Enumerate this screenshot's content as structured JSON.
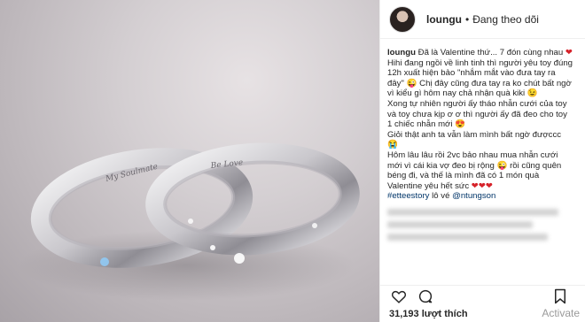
{
  "post": {
    "username": "loungu",
    "follow_separator": "•",
    "follow_status": "Đang theo dõi"
  },
  "caption": {
    "username": "loungu",
    "text_1": "Đã là Valentine thứ... 7 đón cùng nhau",
    "heart_1": "❤",
    "text_2": "Hihi đang ngồi về linh tinh thì người yêu toy đúng 12h xuất hiện bảo \"nhắm mắt vào đưa tay ra đây\" 😜 Chị đây cũng đưa tay ra ko chút bất ngờ vì kiểu gì hôm nay chả nhận quà kiki 😉",
    "text_3": "Xong tự nhiên người ấy tháo nhẫn cưới của toy và toy chưa kịp ơ ơ thì người ấy đã đeo cho toy 1 chiếc nhẫn mới 😍",
    "text_4": "Giỏi thật anh ta vẫn làm mình bất ngờ đượccc 😭",
    "text_5": "Hôm lâu lâu rồi 2vc bảo nhau mua nhẫn cưới mới vì cái kia vợ đeo bị rộng 😜 rồi cũng quên béng đi, và thế là mình đã có 1 món quà Valentine yêu hết sức",
    "hearts_2": "❤❤❤",
    "hashtag": "#etteestory",
    "loves_text": "lô vé",
    "mention": "@ntungson"
  },
  "actions": {
    "like_icon": "heart-icon",
    "comment_icon": "comment-icon",
    "save_icon": "bookmark-icon"
  },
  "likes": "31,193 lượt thích",
  "watermark": "Activate",
  "colors": {
    "heart": "#d6222a",
    "link": "#003569",
    "text": "#262626"
  }
}
